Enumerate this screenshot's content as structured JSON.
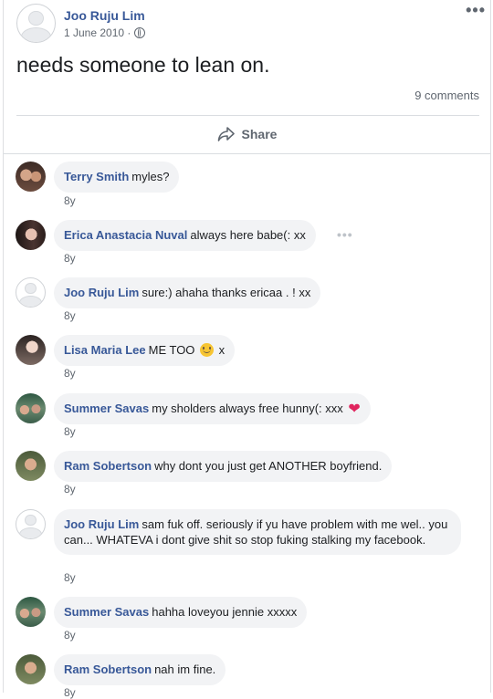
{
  "post": {
    "author": "Joo Ruju Lim",
    "date": "1 June 2010 · ",
    "text": "needs someone to lean on.",
    "comment_count": "9 comments",
    "share_label": "Share",
    "more_label": "•••"
  },
  "comments": [
    {
      "name": "Terry Smith",
      "text": "myles?",
      "time": "8y"
    },
    {
      "name": "Erica Anastacia Nuval",
      "text": "always here babe(: xx",
      "time": "8y",
      "more": "•••"
    },
    {
      "name": "Joo Ruju Lim",
      "text": "sure:) ahaha thanks ericaa . ! xx",
      "time": "8y"
    },
    {
      "name": "Lisa Maria Lee",
      "text": "ME TOO",
      "text_after": "x",
      "time": "8y"
    },
    {
      "name": "Summer Savas",
      "text": "my sholders always free hunny(: xxx",
      "time": "8y"
    },
    {
      "name": "Ram Sobertson",
      "text": "why dont you just get ANOTHER boyfriend.",
      "time": "8y"
    },
    {
      "name": "Joo Ruju Lim",
      "text": "sam fuk off. seriously if yu have problem with me wel.. you can... WHATEVA i dont give shit so stop fuking stalking my facebook.",
      "time": "8y"
    },
    {
      "name": "Summer Savas",
      "text": "hahha loveyou jennie xxxxx",
      "time": "8y"
    },
    {
      "name": "Ram Sobertson",
      "text": "nah im fine.",
      "time": "8y"
    }
  ]
}
